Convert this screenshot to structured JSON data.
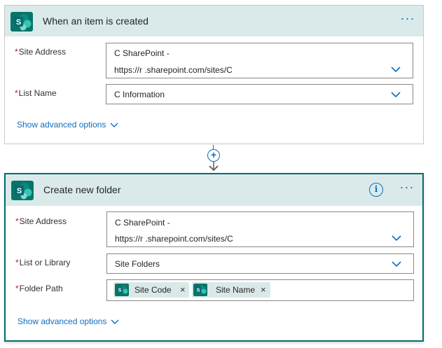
{
  "card1": {
    "title": "When an item is created",
    "more_label": "···",
    "site_address_label": "Site Address",
    "site_address_line1": "C SharePoint -",
    "site_address_line2": "https://r .sharepoint.com/sites/C",
    "list_name_label": "List Name",
    "list_name_value": "C Information",
    "advanced_label": "Show advanced options"
  },
  "connector": {
    "add_label": "+"
  },
  "card2": {
    "title": "Create new folder",
    "info_label": "i",
    "more_label": "···",
    "site_address_label": "Site Address",
    "site_address_line1": "C SharePoint -",
    "site_address_line2": "https://r .sharepoint.com/sites/C",
    "list_label": "List or Library",
    "list_value": "Site Folders",
    "folder_path_label": "Folder Path",
    "tokens": [
      {
        "label": "Site Code",
        "remove": "×"
      },
      {
        "label": "Site Name",
        "remove": "×"
      }
    ],
    "advanced_label": "Show advanced options"
  },
  "colors": {
    "header_bg": "#daeaea",
    "brand": "#077568",
    "accent": "#0f6cbd",
    "selected_border": "#006d6d",
    "required": "#a4262c"
  },
  "icons": {
    "connector": "sharepoint-icon",
    "more": "ellipsis-icon",
    "info": "info-icon",
    "dropdown": "chevron-down-icon",
    "add": "plus-circle-icon",
    "arrow": "arrow-down-icon",
    "remove": "close-icon"
  }
}
